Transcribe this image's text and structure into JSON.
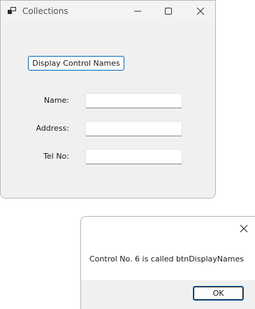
{
  "main_window": {
    "title": "Collections",
    "app_icon": "app-icon",
    "controls": [
      "minimize-icon",
      "maximize-icon",
      "close-icon"
    ],
    "display_button_label": "Display Control Names",
    "fields": [
      {
        "label": "Name:",
        "value": ""
      },
      {
        "label": "Address:",
        "value": ""
      },
      {
        "label": "Tel No:",
        "value": ""
      }
    ]
  },
  "message_box": {
    "close_icon": "close-icon",
    "message": "Control No. 6 is called btnDisplayNames",
    "ok_label": "OK"
  },
  "colors": {
    "window_bg": "#f0f0f0",
    "accent_border": "#0067c0",
    "text": "#1a1a1a"
  }
}
